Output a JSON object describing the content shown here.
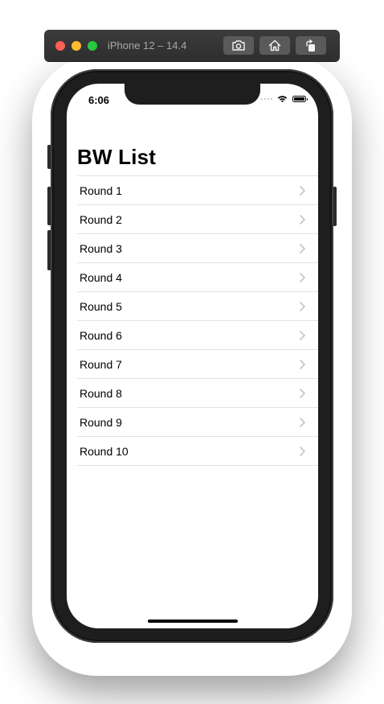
{
  "window": {
    "title": "iPhone 12 – 14.4",
    "buttons": [
      {
        "icon": "camera-icon"
      },
      {
        "icon": "home-icon"
      },
      {
        "icon": "rotate-icon"
      }
    ]
  },
  "status_bar": {
    "time": "6:06"
  },
  "navigation": {
    "title": "BW List"
  },
  "list": {
    "items": [
      {
        "label": "Round 1"
      },
      {
        "label": "Round 2"
      },
      {
        "label": "Round 3"
      },
      {
        "label": "Round 4"
      },
      {
        "label": "Round 5"
      },
      {
        "label": "Round 6"
      },
      {
        "label": "Round 7"
      },
      {
        "label": "Round 8"
      },
      {
        "label": "Round 9"
      },
      {
        "label": "Round 10"
      }
    ]
  },
  "colors": {
    "close": "#fe5f57",
    "minimize": "#febc2e",
    "zoom": "#28c840",
    "separator": "#e3e3e6",
    "chevron": "#c4c4c6"
  }
}
